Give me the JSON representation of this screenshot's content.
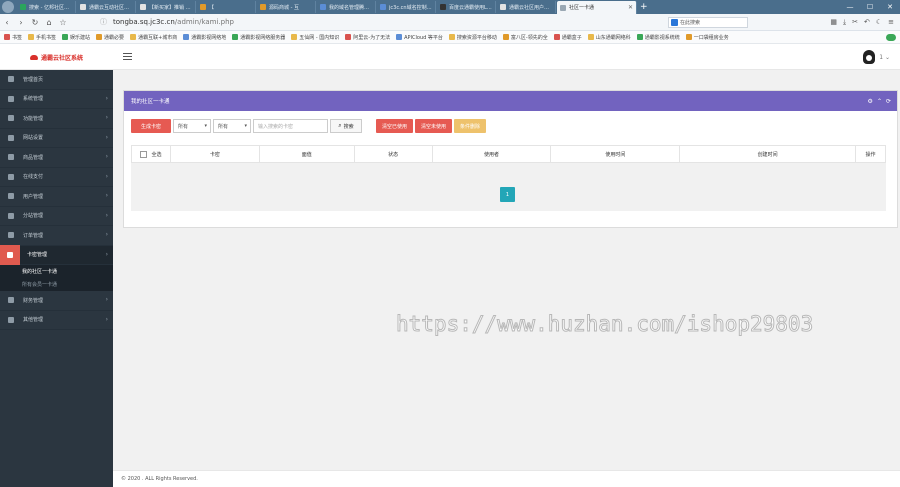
{
  "browser": {
    "tabs": [
      {
        "label": "搜索 - 亿邦社区源码 - 渲",
        "color": "#2aa55c"
      },
      {
        "label": "通霸云互动社区源码测试",
        "color": "#e3e3e3"
      },
      {
        "label": "【新买家】推销 - 营销中心",
        "color": "#e3e3e3"
      },
      {
        "label": "【",
        "color": "#e09a2a"
      },
      {
        "label": "源码商城 - 互",
        "color": "#e09a2a"
      },
      {
        "label": "我的域名管理腾讯云",
        "color": "#5b8dd6"
      },
      {
        "label": "jc3c.cn域名控制面板V2",
        "color": "#5b8dd6"
      },
      {
        "label": "百度云通霸使用Linux部",
        "color": "#333333"
      },
      {
        "label": "通霸云社区用户管理系统",
        "color": "#e3e3e3"
      }
    ],
    "active_tab": "社区一卡通",
    "url_domain": "tongba.sq.jc3c.cn",
    "url_path": "/admin/kami.php",
    "search_placeholder": "在此搜索",
    "bookmarks": [
      "书签",
      "手机书签",
      "娱乐建站",
      "通霸必要",
      "通霸互联+城市商",
      "通霸影视网络地",
      "通霸影视网络服务器",
      "五仙网 - 国内知识",
      "阿里云-为了无法",
      "APICloud 等平台",
      "搜索资源平台移动",
      "富八区-领先的全",
      "通霸盒子",
      "山东通霸网络科",
      "通霸影视系统统",
      "一口袋租房业务"
    ]
  },
  "app": {
    "logo_text": "通霸云社区系统",
    "user_caret": "1 ⌄"
  },
  "sidebar": {
    "items": [
      {
        "label": "管理首页"
      },
      {
        "label": "系统管理"
      },
      {
        "label": "功能管理"
      },
      {
        "label": "网站设置"
      },
      {
        "label": "商品管理"
      },
      {
        "label": "在线支付"
      },
      {
        "label": "用户管理"
      },
      {
        "label": "分站管理"
      },
      {
        "label": "订单管理"
      },
      {
        "label": "卡密管理"
      },
      {
        "label": "财务管理"
      },
      {
        "label": "其他管理"
      }
    ],
    "submenu": [
      "我的社区一卡通",
      "所有会员一卡通"
    ]
  },
  "panel": {
    "title": "我的社区一卡通",
    "buttons": {
      "generate": "生成卡密",
      "clear_used": "清空已使用",
      "clear_unused": "清空未使用",
      "batch_delete": "条件删除",
      "search": "搜索"
    },
    "select1": "所有",
    "select2": "所有",
    "search_placeholder": "输入搜索的卡密",
    "columns": [
      "全选",
      "卡密",
      "面值",
      "状态",
      "使用者",
      "使用时间",
      "创建时间",
      "操作"
    ],
    "page": "1"
  },
  "footer": "© 2020 . ALL Rights Reserved.",
  "watermark": "https://www.huzhan.com/ishop29803"
}
